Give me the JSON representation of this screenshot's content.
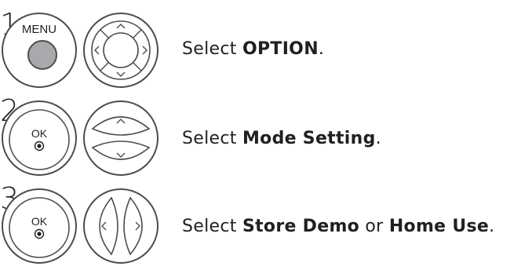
{
  "steps": [
    {
      "number": "1",
      "button_label": "MENU",
      "instruction": {
        "prefix": "Select ",
        "target": "OPTION",
        "suffix": "."
      }
    },
    {
      "number": "2",
      "button_label": "OK",
      "instruction": {
        "prefix": "Select ",
        "target": "Mode Setting",
        "suffix": "."
      }
    },
    {
      "number": "3",
      "button_label": "OK",
      "instruction": {
        "prefix": "Select ",
        "target": "Store Demo",
        "connector": " or ",
        "target2": "Home Use",
        "suffix": "."
      }
    }
  ],
  "colors": {
    "text": "#231f20",
    "outline": "#4d4d4f",
    "menu_button_fill": "#a7a9ac",
    "key_fill": "#ffffff"
  },
  "icons": {
    "menu_key": "menu-button-icon",
    "ok_key": "ok-button-icon",
    "four_way_nav": "four-way-navigation-icon",
    "up_down_nav": "up-down-navigation-icon",
    "left_right_nav": "left-right-navigation-icon"
  }
}
